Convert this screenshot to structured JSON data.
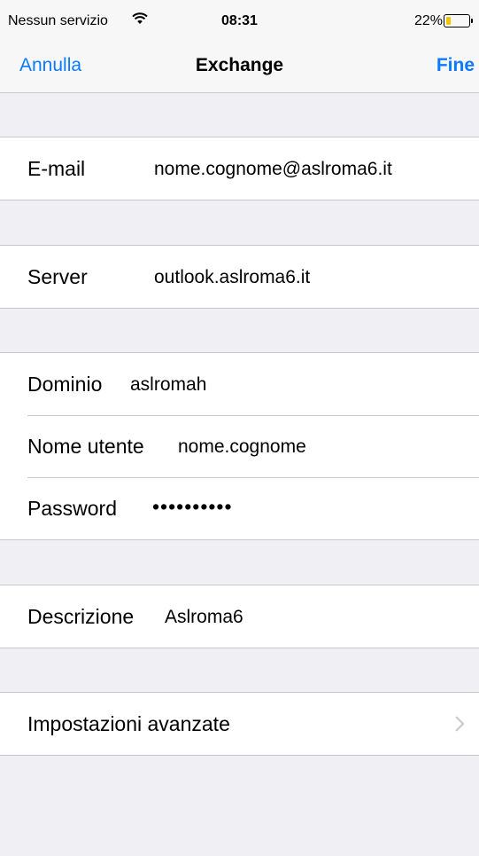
{
  "status_bar": {
    "carrier": "Nessun servizio",
    "time": "08:31",
    "battery_percent": "22%",
    "battery_level": 0.22,
    "battery_color": "#f2c500",
    "wifi_icon": "wifi-icon"
  },
  "nav": {
    "cancel_label": "Annulla",
    "title": "Exchange",
    "done_label": "Fine",
    "accent_color": "#0a7aff"
  },
  "account": {
    "email_label": "E-mail",
    "email_value": "nome.cognome@aslroma6.it",
    "server_label": "Server",
    "server_value": "outlook.aslroma6.it",
    "domain_label": "Dominio",
    "domain_value": "aslromah",
    "username_label": "Nome utente",
    "username_value": "nome.cognome",
    "password_label": "Password",
    "password_value": "••••••••••",
    "description_label": "Descrizione",
    "description_value": "Aslroma6",
    "advanced_label": "Impostazioni avanzate",
    "advanced_icon": "chevron-right-icon"
  }
}
